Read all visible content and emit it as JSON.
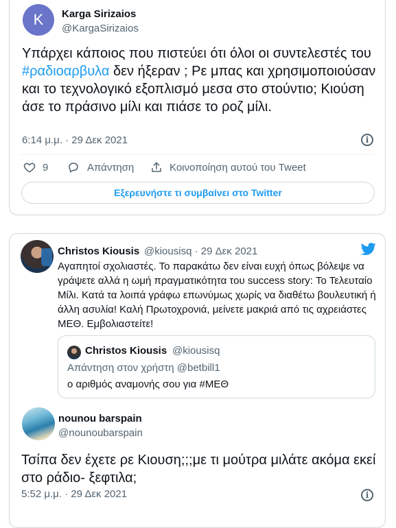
{
  "tweet1": {
    "avatar_letter": "K",
    "author_name": "Karga Sirizaios",
    "author_handle": "@KargaSirizaios",
    "text_before": "Υπάρχει κάποιος που πιστεύει ότι όλοι οι συντελεστές του ",
    "hashtag": "#ραδιοαρβυλα",
    "text_after": " δεν ήξεραν ; Ρε μπας και χρησιμοποιούσαν και το τεχνολογικό εξοπλισμό μεσα στο στούντιο; Κιούση άσε το πράσινο μίλι και πιάσε το ροζ μίλι.",
    "timestamp": "6:14 μ.μ. · 29 Δεκ 2021",
    "likes": "9",
    "reply_label": "Απάντηση",
    "share_label": "Κοινοποίηση αυτού του Tweet",
    "explore_label": "Εξερευνήστε τι συμβαίνει στο Twitter"
  },
  "tweet2": {
    "author_name": "Christos Kiousis",
    "author_handle_date": "@kiousisq · 29 Δεκ 2021",
    "text": "Αγαπητοί σχολιαστές. Το παρακάτω δεν είναι ευχή όπως βόλεψε να γράψετε αλλά η ωμή πραγματικότητα του success story: Το Τελευταίο Μίλι. Κατά τα λοιπά γράφω επωνύμως χωρίς να διαθέτω βουλευτική ή άλλη ασυλία! Καλή Πρωτοχρονιά, μείνετε μακριά από τις αχρειάστες ΜΕΘ. Εμβολιαστείτε!",
    "quote": {
      "author_name": "Christos Kiousis",
      "author_handle": "@kiousisq",
      "reply_to": "Απάντηση στον χρήστη @betbill1",
      "text": "ο αριθμός αναμονής σου για #ΜΕΘ"
    }
  },
  "tweet3": {
    "author_name": "nounou barspain",
    "author_handle": "@nounoubarspain",
    "text": "Τσίπα δεν έχετε ρε Κιουση;;;με τι μούτρα μιλάτε ακόμα εκεί στο ράδιο- ξεφτιλα;",
    "timestamp": "5:52 μ.μ. · 29 Δεκ 2021"
  },
  "colors": {
    "accent": "#1d9bf0",
    "text": "#0f1419",
    "secondary": "#536471",
    "border": "#cfd9de",
    "avatar_k": "#6a74c9"
  },
  "icons": [
    "info-icon",
    "heart-icon",
    "reply-icon",
    "share-icon",
    "twitter-bird-icon"
  ]
}
